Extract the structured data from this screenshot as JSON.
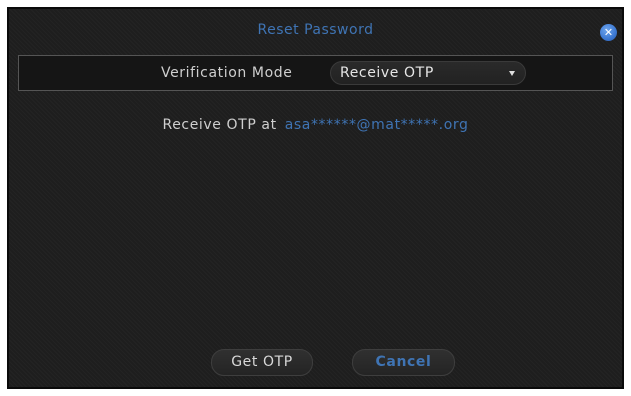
{
  "dialog": {
    "title": "Reset Password",
    "close_icon": "close-circle-icon",
    "close_glyph": "✕",
    "accent_color": "#3f74b4"
  },
  "verification": {
    "label": "Verification Mode",
    "selected": "Receive OTP"
  },
  "otp": {
    "label": "Receive OTP at",
    "destination": "asa******@mat*****.org"
  },
  "actions": {
    "get_otp_label": "Get OTP",
    "cancel_label": "Cancel"
  }
}
